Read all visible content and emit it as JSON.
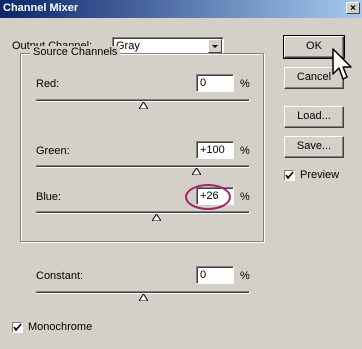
{
  "window": {
    "title": "Channel Mixer",
    "close_glyph": "×"
  },
  "output_channel": {
    "label": "Output Channel:",
    "value": "Gray"
  },
  "source_channels": {
    "title": "Source Channels",
    "channels": [
      {
        "label": "Red:",
        "value": "0",
        "unit": "%",
        "level_percent": 0
      },
      {
        "label": "Green:",
        "value": "+100",
        "unit": "%",
        "level_percent": 100
      },
      {
        "label": "Blue:",
        "value": "+26",
        "unit": "%",
        "level_percent": 26
      }
    ]
  },
  "constant": {
    "label": "Constant:",
    "value": "0",
    "unit": "%",
    "level_percent": 0
  },
  "buttons": {
    "ok": "OK",
    "cancel": "Cancel",
    "load": "Load...",
    "save": "Save..."
  },
  "preview": {
    "label": "Preview",
    "checked": true
  },
  "monochrome": {
    "label": "Monochrome",
    "checked": true
  },
  "accent_colors": {
    "title_bar": "#0a246a",
    "highlight_ring": "#a0216e"
  },
  "icons": {
    "cursor": "arrow-cursor-icon"
  }
}
